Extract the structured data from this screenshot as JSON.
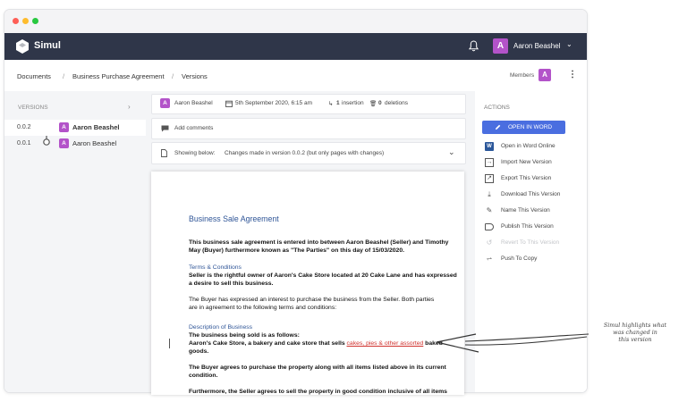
{
  "app": {
    "brand": "Simul"
  },
  "topbar": {
    "user_initial": "A",
    "user_name": "Aaron Beashel"
  },
  "breadcrumb": {
    "items": [
      "Documents",
      "Business Purchase Agreement",
      "Versions"
    ],
    "separator": "/"
  },
  "members": {
    "label": "Members",
    "initial": "A"
  },
  "versions": {
    "title": "VERSIONS",
    "items": [
      {
        "number": "0.0.2",
        "initial": "A",
        "author": "Aaron Beashel"
      },
      {
        "number": "0.0.1",
        "initial": "A",
        "author": "Aaron Beashel"
      }
    ]
  },
  "meta": {
    "initial": "A",
    "author": "Aaron Beashel",
    "date": "5th September 2020, 6:15 am",
    "insertions_count": "1",
    "insertions_label": "insertion",
    "deletions_count": "0",
    "deletions_label": "deletions"
  },
  "comments": {
    "label": "Add comments"
  },
  "showing": {
    "label": "Showing below:",
    "value": "Changes made in version 0.0.2 (but only pages with changes)"
  },
  "document": {
    "title": "Business Sale Agreement",
    "p1_line1": "This business sale agreement is entered into between Aaron Beashel (Seller) and Timothy",
    "p1_line2": "May (Buyer) furthermore known as \"The Parties\"  on this day of 15/03/2020.",
    "h_terms": "Terms & Conditions",
    "terms_line1": "Seller is the rightful owner of Aaron's Cake Store located at 20 Cake Lane and has expressed",
    "terms_line2": "a desire to sell this business.",
    "buyer_line1": "The Buyer has expressed an interest to purchase the business from the Seller. Both parties",
    "buyer_line2": "are in agreement to the following terms and conditions:",
    "h_desc": "Description of Business",
    "desc_line1": "The business being sold is as follows:",
    "desc_line2_pre": "Aaron's Cake Store, a bakery and cake store that sells ",
    "desc_line2_changed": "cakes, pies & other assorted",
    "desc_line2_post": " baked",
    "desc_line3": "goods.",
    "agree_line1": "The Buyer agrees to purchase the property along with all items listed above in its current",
    "agree_line2": "condition.",
    "further_line": "Furthermore, the Seller agrees to sell the property in good condition inclusive of all items"
  },
  "actions": {
    "title": "ACTIONS",
    "primary": "OPEN IN WORD",
    "items": [
      {
        "label": "Open in Word Online",
        "icon": "word-icon",
        "enabled": true
      },
      {
        "label": "Import New Version",
        "icon": "import-icon",
        "enabled": true
      },
      {
        "label": "Export This Version",
        "icon": "export-icon",
        "enabled": true
      },
      {
        "label": "Download This Version",
        "icon": "download-icon",
        "enabled": true
      },
      {
        "label": "Name This Version",
        "icon": "pencil-icon",
        "enabled": true
      },
      {
        "label": "Publish This Version",
        "icon": "tag-icon",
        "enabled": true
      },
      {
        "label": "Revert To This Version",
        "icon": "revert-icon",
        "enabled": false
      },
      {
        "label": "Push To Copy",
        "icon": "branch-icon",
        "enabled": true
      }
    ]
  },
  "annotation": {
    "line1": "Simul highlights what",
    "line2": "was changed in",
    "line3": "this version"
  },
  "colors": {
    "topbar": "#2f3649",
    "accent": "#4a6ee0",
    "avatar": "#b353c9",
    "heading_blue": "#2f5597",
    "change_red": "#d0312d"
  }
}
